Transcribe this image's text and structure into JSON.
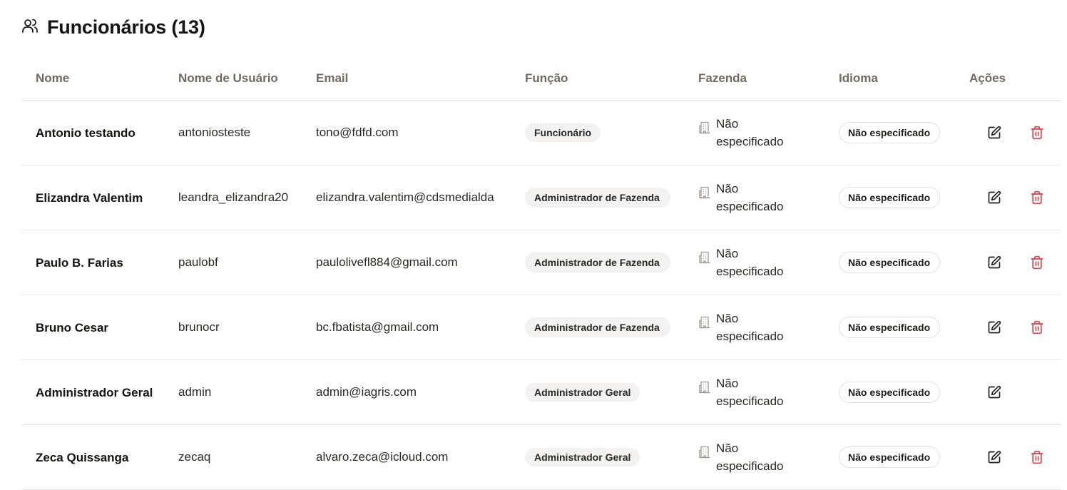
{
  "header": {
    "title": "Funcionários (13)",
    "icon": "users-icon"
  },
  "table": {
    "columns": [
      "Nome",
      "Nome de Usuário",
      "Email",
      "Função",
      "Fazenda",
      "Idioma",
      "Ações"
    ],
    "rows": [
      {
        "name": "Antonio testando",
        "username": "antoniosteste",
        "email": "tono@fdfd.com",
        "role": "Funcionário",
        "farm": "Não especificado",
        "language": "Não especificado",
        "deletable": true
      },
      {
        "name": "Elizandra Valentim",
        "username": "leandra_elizandra20",
        "email": "elizandra.valentim@cdsmedialda",
        "role": "Administrador de Fazenda",
        "farm": "Não especificado",
        "language": "Não especificado",
        "deletable": true
      },
      {
        "name": "Paulo B. Farias",
        "username": "paulobf",
        "email": "paulolivefl884@gmail.com",
        "role": "Administrador de Fazenda",
        "farm": "Não especificado",
        "language": "Não especificado",
        "deletable": true
      },
      {
        "name": "Bruno Cesar",
        "username": "brunocr",
        "email": "bc.fbatista@gmail.com",
        "role": "Administrador de Fazenda",
        "farm": "Não especificado",
        "language": "Não especificado",
        "deletable": true
      },
      {
        "name": "Administrador Geral",
        "username": "admin",
        "email": "admin@iagris.com",
        "role": "Administrador Geral",
        "farm": "Não especificado",
        "language": "Não especificado",
        "deletable": false
      },
      {
        "name": "Zeca Quissanga",
        "username": "zecaq",
        "email": "alvaro.zeca@icloud.com",
        "role": "Administrador Geral",
        "farm": "Não especificado",
        "language": "Não especificado",
        "deletable": true
      }
    ]
  },
  "colors": {
    "delete": "#e0414a",
    "badge_bg": "#f3f2f0",
    "border": "#e7e5e1",
    "header_text": "#6f6a63"
  },
  "icons": {
    "farm": "building-icon",
    "edit": "edit-icon",
    "delete": "trash-icon"
  }
}
